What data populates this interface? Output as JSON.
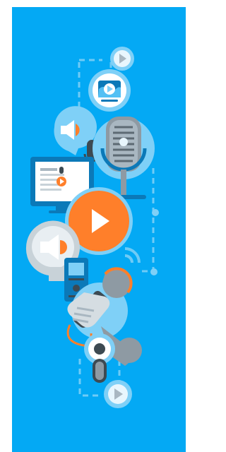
{
  "banner": {
    "type": "illustration",
    "theme": "audio-podcast-media",
    "colors": {
      "background": "#04A9F4",
      "accent": "#FF7F2A",
      "light_blue": "#7FD0F7",
      "dark_blue": "#0B79B8",
      "grey": "#8E9AA3",
      "dark_grey": "#3D4A52",
      "white": "#FFFFFF"
    },
    "icons": [
      "play-bubble-icon",
      "video-player-icon",
      "speaker-head-icon",
      "condenser-microphone-icon",
      "monitor-icon",
      "play-button-icon",
      "profile-speaker-icon",
      "voice-recorder-icon",
      "broadcast-waves-icon",
      "hand-microphone-icon",
      "earbud-icon"
    ]
  }
}
